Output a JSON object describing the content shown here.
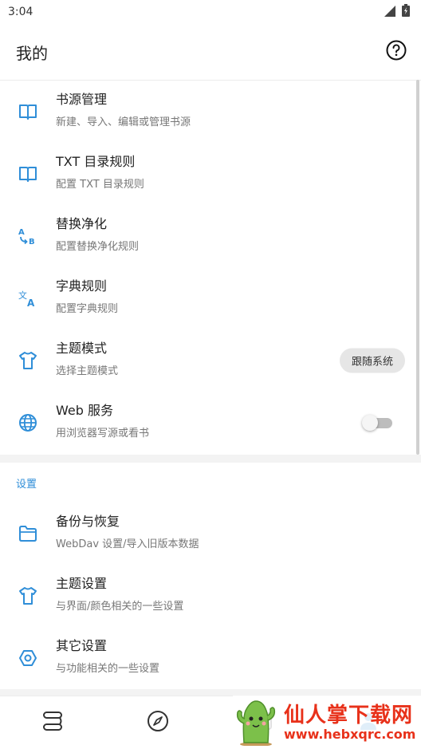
{
  "status": {
    "time": "3:04",
    "icons": [
      "signal-icon",
      "battery-icon"
    ]
  },
  "app_bar": {
    "title": "我的",
    "help_icon": "help-circle-icon"
  },
  "main_items": [
    {
      "title": "书源管理",
      "subtitle": "新建、导入、编辑或管理书源",
      "icon": "book-open-icon"
    },
    {
      "title": "TXT 目录规则",
      "subtitle": "配置 TXT 目录规则",
      "icon": "book-open-icon"
    },
    {
      "title": "替换净化",
      "subtitle": "配置替换净化规则",
      "icon": "replace-ab-icon"
    },
    {
      "title": "字典规则",
      "subtitle": "配置字典规则",
      "icon": "translate-icon"
    },
    {
      "title": "主题模式",
      "subtitle": "选择主题模式",
      "icon": "tshirt-icon",
      "value": "跟随系统"
    },
    {
      "title": "Web 服务",
      "subtitle": "用浏览器写源或看书",
      "icon": "globe-icon",
      "toggle": false
    }
  ],
  "settings": {
    "header": "设置",
    "items": [
      {
        "title": "备份与恢复",
        "subtitle": "WebDav 设置/导入旧版本数据",
        "icon": "folder-icon"
      },
      {
        "title": "主题设置",
        "subtitle": "与界面/颜色相关的一些设置",
        "icon": "tshirt-icon"
      },
      {
        "title": "其它设置",
        "subtitle": "与功能相关的一些设置",
        "icon": "hexagon-settings-icon"
      }
    ]
  },
  "bottom_nav": [
    "bookshelf-icon",
    "compass-icon",
    "rss-icon",
    "person-icon"
  ],
  "watermark": {
    "main": "仙人掌下载网",
    "url": "www.hebxqrc.com"
  },
  "colors": {
    "accent": "#2f8ed8",
    "watermark": "#e8311a"
  }
}
